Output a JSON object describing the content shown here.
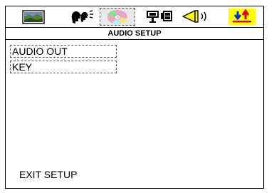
{
  "screen": {
    "title": "AUDIO SETUP"
  },
  "tabs": [
    {
      "icon": "picture-icon",
      "selected": false
    },
    {
      "icon": "language-icon",
      "selected": false
    },
    {
      "icon": "disc-icon",
      "selected": true
    },
    {
      "icon": "speaker-box-icon",
      "selected": false
    },
    {
      "icon": "sound-icon",
      "selected": false
    },
    {
      "icon": "key-arrows-icon",
      "selected": false,
      "highlight_color": "#ffff00"
    }
  ],
  "menu": {
    "items": [
      {
        "label": "AUDIO OUT"
      },
      {
        "label": "KEY"
      }
    ]
  },
  "footer": {
    "exit_label": "EXIT SETUP"
  },
  "colors": {
    "border": "#000000",
    "selection_background": "#e8e8e8",
    "key_tab_background": "#ffff00",
    "arrow_red": "#e00000",
    "arrow_blue": "#0030c0"
  }
}
